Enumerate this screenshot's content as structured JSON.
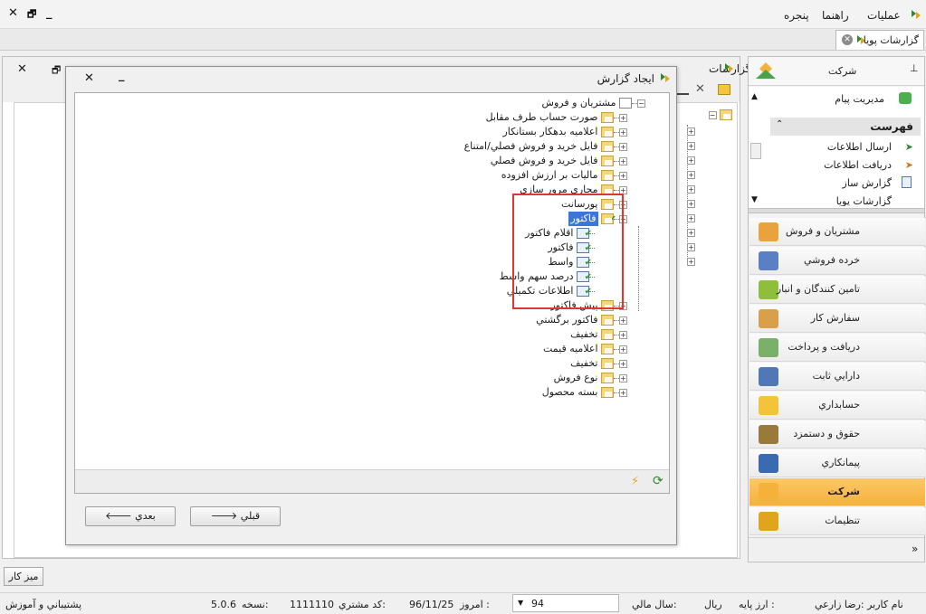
{
  "menubar": {
    "items": [
      "عمليات",
      "راهنما",
      "پنجره"
    ]
  },
  "doc_tab": {
    "title": "گزارشات پويا"
  },
  "left_window": {
    "title": "گزارشات"
  },
  "dialog": {
    "title": "ايجاد گزارش",
    "tree": [
      {
        "label": "مشتريان و فروش",
        "level": 0
      },
      {
        "label": "صورت حساب طرف مقابل",
        "level": 1
      },
      {
        "label": "اعلاميه بدهكار بستانكار",
        "level": 1
      },
      {
        "label": "فايل خريد و فروش فصلي/امتناع",
        "level": 1
      },
      {
        "label": "فايل خريد و فروش فصلي",
        "level": 1
      },
      {
        "label": "ماليات بر ارزش افزوده",
        "level": 1
      },
      {
        "label": "مجاري مرور سازي",
        "level": 1
      },
      {
        "label": "پورسانت",
        "level": 1
      },
      {
        "label": "فاكتور",
        "level": 1
      },
      {
        "label": "اقلام فاكتور",
        "level": 2
      },
      {
        "label": "فاكتور",
        "level": 2
      },
      {
        "label": "واسط",
        "level": 2
      },
      {
        "label": "درصد سهم واسط",
        "level": 2
      },
      {
        "label": "اطلاعات تكميلي",
        "level": 2
      },
      {
        "label": "پيش فاكتور",
        "level": 1
      },
      {
        "label": "فاكتور برگشتي",
        "level": 1
      },
      {
        "label": "تخفيف",
        "level": 1
      },
      {
        "label": "اعلاميه قيمت",
        "level": 1
      },
      {
        "label": "تخفيف",
        "level": 1
      },
      {
        "label": "نوع فروش",
        "level": 1
      },
      {
        "label": "بسته محصول",
        "level": 1
      }
    ],
    "buttons": {
      "next": "بعدي",
      "prev": "قبلي"
    }
  },
  "right_panel": {
    "header": "شركت",
    "top_item": "مديريت پيام",
    "list_header": "فهرست",
    "list_items": [
      "ارسال اطلاعات",
      "دريافت اطلاعات",
      "گزارش ساز",
      "گزارشات پويا"
    ],
    "nav": [
      "مشتريان و فروش",
      "خرده فروشي",
      "تامين كنندگان و انبار",
      "سفارش كار",
      "دريافت و پرداخت",
      "دارايي ثابت",
      "حسابداري",
      "حقوق و دستمزد",
      "پيمانكاري",
      "شركت",
      "تنظيمات"
    ],
    "active_nav": "شركت"
  },
  "desktop_button": "ميز كار",
  "status": {
    "user_label": "نام كاربر :رضا زارعي",
    "currency": "ارز پايه :",
    "currency_value": "ريال",
    "fiscal_year_label": "سال مالي:",
    "fiscal_year_value": "94",
    "today_label": "امروز :",
    "today_value": "96/11/25",
    "customer_code_label": "كد مشتري:",
    "customer_code_value": "1111110",
    "version_label": "نسخه:",
    "version_value": "5.0.6",
    "support": "پشتيباني و آموزش"
  },
  "colors": {
    "active_nav": "#f6b13a",
    "selection": "#3a78d8",
    "highlight_box": "#e3342f"
  }
}
